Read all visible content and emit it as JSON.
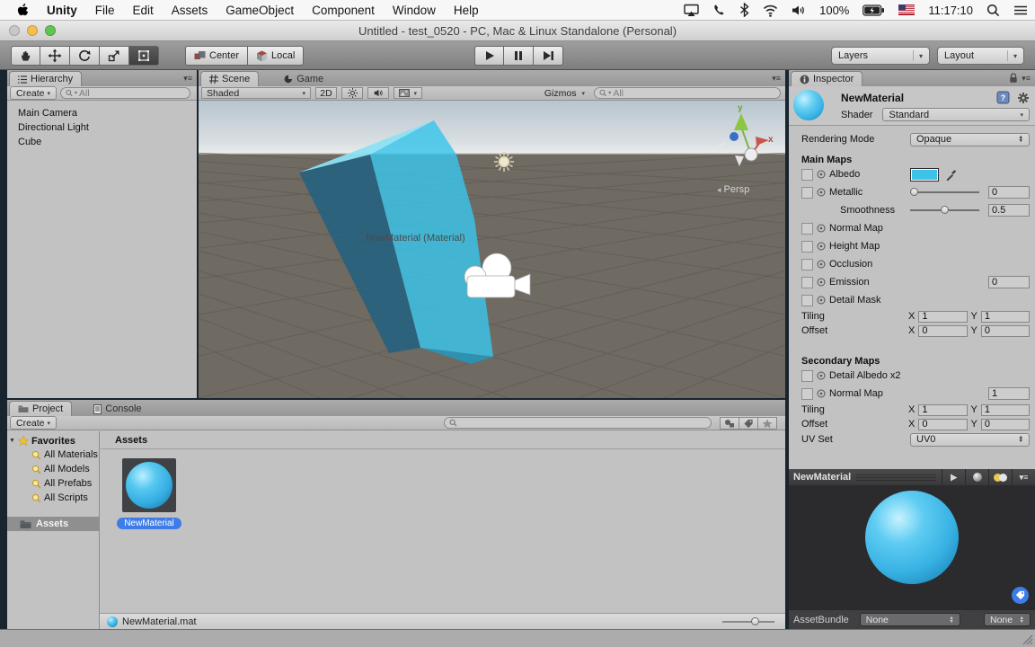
{
  "menubar": {
    "items": [
      "Unity",
      "File",
      "Edit",
      "Assets",
      "GameObject",
      "Component",
      "Window",
      "Help"
    ],
    "battery": "100%",
    "time": "11:17:10"
  },
  "titlebar": {
    "title": "Untitled - test_0520 - PC, Mac & Linux Standalone (Personal)"
  },
  "toolbar": {
    "center": "Center",
    "local": "Local",
    "layers": "Layers",
    "layout": "Layout"
  },
  "hierarchy": {
    "tab": "Hierarchy",
    "create": "Create",
    "search": "All",
    "items": [
      "Main Camera",
      "Directional Light",
      "Cube"
    ]
  },
  "scene": {
    "tab_scene": "Scene",
    "tab_game": "Game",
    "shading": "Shaded",
    "btn_2d": "2D",
    "gizmos": "Gizmos",
    "search": "All",
    "material_label": "NewMaterial (Material)",
    "persp": "Persp",
    "axis_x": "x",
    "axis_y": "y"
  },
  "inspector": {
    "tab": "Inspector",
    "material_name": "NewMaterial",
    "shader_label": "Shader",
    "shader_value": "Standard",
    "rendering_mode_label": "Rendering Mode",
    "rendering_mode_value": "Opaque",
    "main_maps_header": "Main Maps",
    "albedo": "Albedo",
    "metallic": "Metallic",
    "metallic_value": "0",
    "smoothness": "Smoothness",
    "smoothness_value": "0.5",
    "normal_map": "Normal Map",
    "height_map": "Height Map",
    "occlusion": "Occlusion",
    "emission": "Emission",
    "emission_value": "0",
    "detail_mask": "Detail Mask",
    "tiling_label": "Tiling",
    "offset_label": "Offset",
    "x_label": "X",
    "y_label": "Y",
    "tiling_x": "1",
    "tiling_y": "1",
    "offset_x": "0",
    "offset_y": "0",
    "secondary_maps_header": "Secondary Maps",
    "detail_albedo": "Detail Albedo x2",
    "secondary_normal_map": "Normal Map",
    "secondary_normal_value": "1",
    "secondary_tiling_x": "1",
    "secondary_tiling_y": "1",
    "secondary_offset_x": "0",
    "secondary_offset_y": "0",
    "uv_set_label": "UV Set",
    "uv_set_value": "UV0",
    "preview_title": "NewMaterial",
    "assetbundle_label": "AssetBundle",
    "assetbundle_value": "None",
    "assetbundle_variant": "None"
  },
  "project": {
    "tab_project": "Project",
    "tab_console": "Console",
    "create": "Create",
    "favorites": "Favorites",
    "favorite_items": [
      "All Materials",
      "All Models",
      "All Prefabs",
      "All Scripts"
    ],
    "assets_folder": "Assets",
    "assets_header": "Assets",
    "asset_name": "NewMaterial",
    "selected_file": "NewMaterial.mat"
  },
  "colors": {
    "albedo_swatch": "#3FC2E8",
    "selection_blue": "#3E7DE7",
    "cube_face": "#39C5EA"
  }
}
